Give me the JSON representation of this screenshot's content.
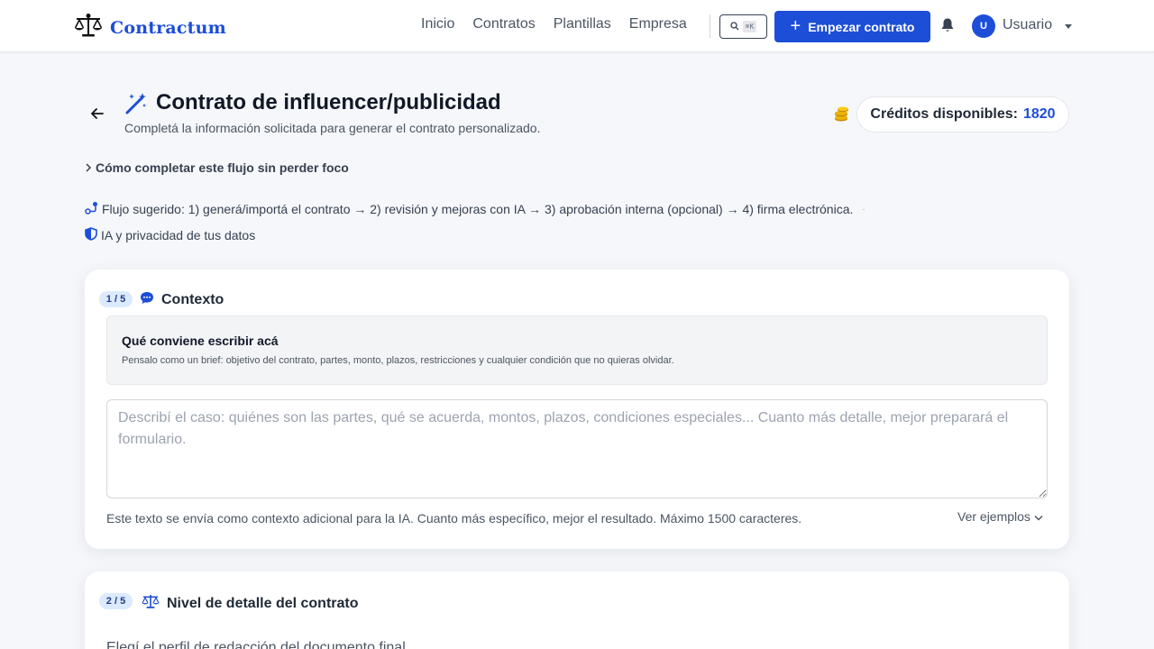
{
  "navbar": {
    "brand": "Contractum",
    "links": [
      "Inicio",
      "Contratos",
      "Plantillas",
      "Empresa"
    ],
    "search_shortcut": "⌘K",
    "cta_label": "Empezar contrato",
    "user_initial": "U",
    "user_name": "Usuario"
  },
  "header": {
    "title": "Contrato de influencer/publicidad",
    "subtitle": "Completá la información solicitada para generar el contrato personalizado.",
    "credits_label": "Créditos disponibles:",
    "credits_value": "1820"
  },
  "info": {
    "howto": "Cómo completar este flujo sin perder foco",
    "flow": "Flujo sugerido: 1) generá/importá el contrato → 2) revisión y mejoras con IA → 3) aprobación interna (opcional) → 4) firma electrónica.",
    "flow_dot": "·",
    "privacy": "IA y privacidad de tus datos"
  },
  "step1": {
    "badge": "1 / 5",
    "title": "Contexto",
    "tips_title": "Qué conviene escribir acá",
    "tips_text": "Pensalo como un brief: objetivo del contrato, partes, monto, plazos, restricciones y cualquier condición que no quieras olvidar.",
    "textarea_value": "",
    "textarea_placeholder": "Describí el caso: quiénes son las partes, qué se acuerda, montos, plazos, condiciones especiales... Cuanto más detalle, mejor preparará el formulario.",
    "helper": "Este texto se envía como contexto adicional para la IA. Cuanto más específico, mejor el resultado. Máximo 1500 caracteres.",
    "examples_link": "Ver ejemplos"
  },
  "step2": {
    "badge": "2 / 5",
    "title": "Nivel de detalle del contrato",
    "subtitle": "Elegí el perfil de redacción del documento final."
  },
  "colors": {
    "primary": "#1d4ed8",
    "badge_bg": "#dbeafe",
    "coin": "#eab308"
  }
}
